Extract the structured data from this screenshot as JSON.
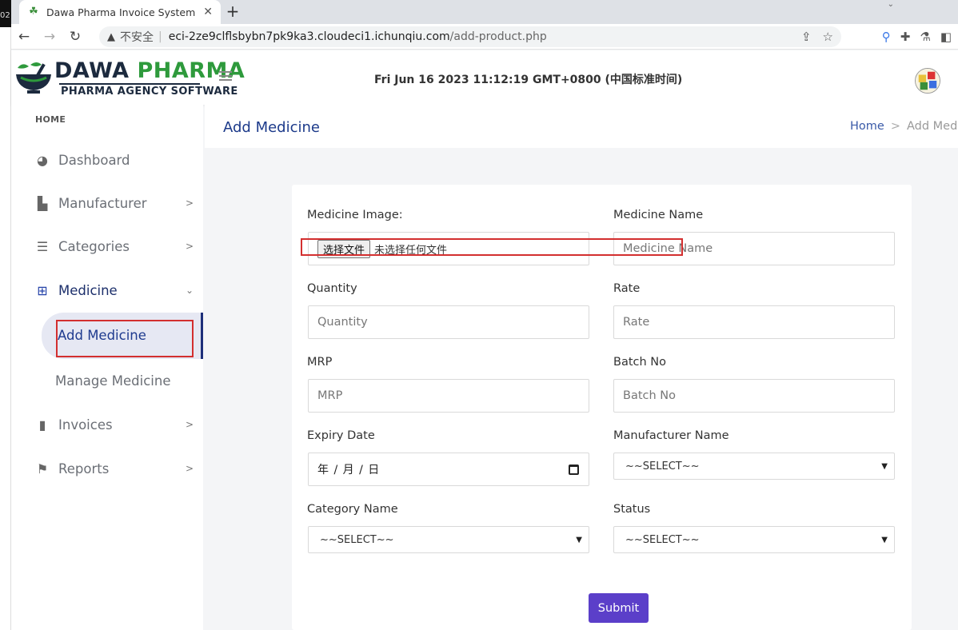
{
  "desktop_edge_text": "02",
  "browser": {
    "tab_title": "Dawa Pharma Invoice System",
    "tab_close": "✕",
    "new_tab": "+",
    "insecure_label": "不安全",
    "url_host": "eci-2ze9clflsbybn7pk9ka3.cloudeci1.ichunqiu.com",
    "url_path": "/add-product.php"
  },
  "header": {
    "brand_part1": "DAWA",
    "brand_part2": "PHARMA",
    "tagline": "PHARMA AGENCY SOFTWARE",
    "datetime": "Fri Jun 16 2023 11:12:19 GMT+0800 (中国标准时间)"
  },
  "sidebar": {
    "home": "HOME",
    "items": [
      {
        "label": "Dashboard",
        "icon": "dashboard-icon"
      },
      {
        "label": "Manufacturer",
        "icon": "factory-icon"
      },
      {
        "label": "Categories",
        "icon": "list-icon"
      },
      {
        "label": "Medicine",
        "icon": "medkit-icon"
      },
      {
        "label": "Invoices",
        "icon": "file-icon"
      },
      {
        "label": "Reports",
        "icon": "flag-icon"
      }
    ],
    "sub_active": "Add Medicine",
    "sub_item": "Manage Medicine"
  },
  "page": {
    "title": "Add Medicine",
    "breadcrumb_home": "Home",
    "breadcrumb_current": "Add Medi"
  },
  "form": {
    "image_label": "Medicine Image:",
    "file_button": "选择文件",
    "file_status": "未选择任何文件",
    "name_label": "Medicine Name",
    "name_placeholder": "Medicine Name",
    "quantity_label": "Quantity",
    "quantity_placeholder": "Quantity",
    "rate_label": "Rate",
    "rate_placeholder": "Rate",
    "mrp_label": "MRP",
    "mrp_placeholder": "MRP",
    "batch_label": "Batch No",
    "batch_placeholder": "Batch No",
    "expiry_label": "Expiry Date",
    "expiry_value": "年 / 月 / 日",
    "manufacturer_label": "Manufacturer Name",
    "manufacturer_value": "~~SELECT~~",
    "category_label": "Category Name",
    "category_value": "~~SELECT~~",
    "status_label": "Status",
    "status_value": "~~SELECT~~",
    "submit": "Submit"
  }
}
